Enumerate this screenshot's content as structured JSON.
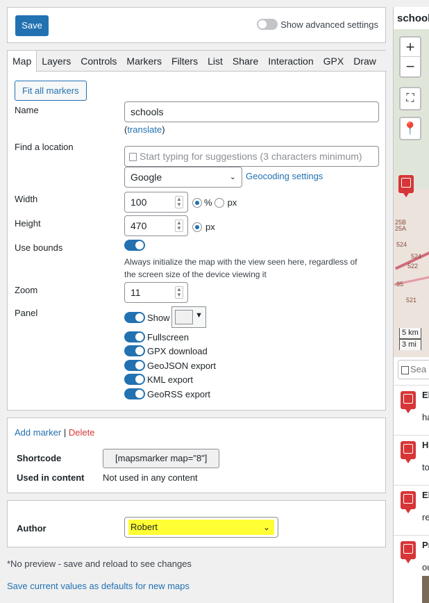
{
  "top": {
    "save_label": "Save",
    "advanced_label": "Show advanced settings"
  },
  "tabs": [
    "Map",
    "Layers",
    "Controls",
    "Markers",
    "Filters",
    "List",
    "Share",
    "Interaction",
    "GPX",
    "Draw"
  ],
  "map_settings": {
    "fit_markers_label": "Fit all markers",
    "name_label": "Name",
    "name_value": "schools",
    "translate_link": "translate",
    "find_location_label": "Find a location",
    "find_location_placeholder": "Start typing for suggestions (3 characters minimum)",
    "geocoder_value": "Google",
    "geocoding_settings_link": "Geocoding settings",
    "width_label": "Width",
    "width_value": "100",
    "width_unit_percent": "%",
    "width_unit_px": "px",
    "height_label": "Height",
    "height_value": "470",
    "height_unit_px": "px",
    "use_bounds_label": "Use bounds",
    "use_bounds_desc_1": "Always initialize the map with the view seen here, regardless of",
    "use_bounds_desc_2": "the screen size of the device viewing it",
    "zoom_label": "Zoom",
    "zoom_value": "11",
    "panel_label": "Panel",
    "panel_show": "Show",
    "panel_options": [
      "Fullscreen",
      "GPX download",
      "GeoJSON export",
      "KML export",
      "GeoRSS export"
    ]
  },
  "marker_box": {
    "add_marker": "Add marker",
    "separator": "|",
    "delete": "Delete",
    "shortcode_label": "Shortcode",
    "shortcode_value": "[mapsmarker map=\"8\"]",
    "used_label": "Used in content",
    "used_value": "Not used in any content"
  },
  "author_box": {
    "label": "Author",
    "value": "Robert",
    "highlight_color": "#ffff33"
  },
  "footer": {
    "note": "*No preview - save and reload to see changes",
    "defaults_link": "Save current values as defaults for new maps"
  },
  "preview": {
    "title": "school",
    "zoom_in": "+",
    "zoom_out": "−",
    "scale_km": "5 km",
    "scale_mi": "3 mi",
    "search_placeholder": "Sea",
    "road_labels": [
      "25B",
      "25A",
      "524",
      "524",
      "522",
      "85",
      "521"
    ],
    "list_titles": [
      "El",
      "H",
      "El",
      "Pr"
    ],
    "list_snippets": [
      "ha",
      "to",
      "re",
      "ou"
    ]
  },
  "colors": {
    "accent": "#2271b1",
    "danger": "#d63638",
    "marker": "#d63638"
  }
}
